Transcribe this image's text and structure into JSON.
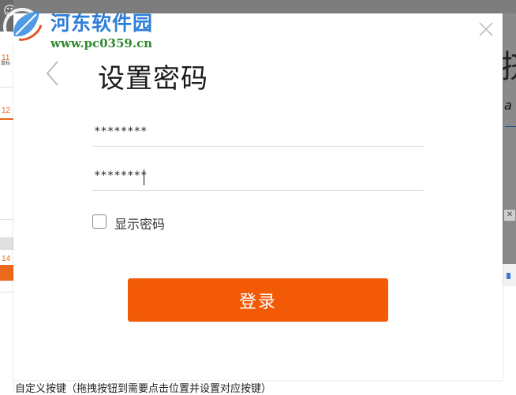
{
  "watermark": {
    "name": "河东软件园",
    "url": "www.pc0359.cn"
  },
  "background": {
    "sidebar_numbers": [
      "11",
      "12",
      "14"
    ],
    "sidebar_mini_text": "鼠标",
    "right_big_char": "挤",
    "right_italic": "a",
    "bottom_hint": "自定义按键（拖拽按钮到需要点击位置并设置对应按键）"
  },
  "dialog": {
    "title": "设置密码",
    "password_value": "********",
    "confirm_value": "********",
    "show_password_label": "显示密码",
    "show_password_checked": false,
    "login_label": "登录"
  },
  "colors": {
    "accent": "#f25a06",
    "watermark_blue": "#2f7fd8",
    "watermark_green": "#2f8a2f"
  },
  "icons": {
    "back": "chevron-left-icon",
    "close": "close-icon",
    "watermark_logo": "leaf-logo-icon"
  }
}
